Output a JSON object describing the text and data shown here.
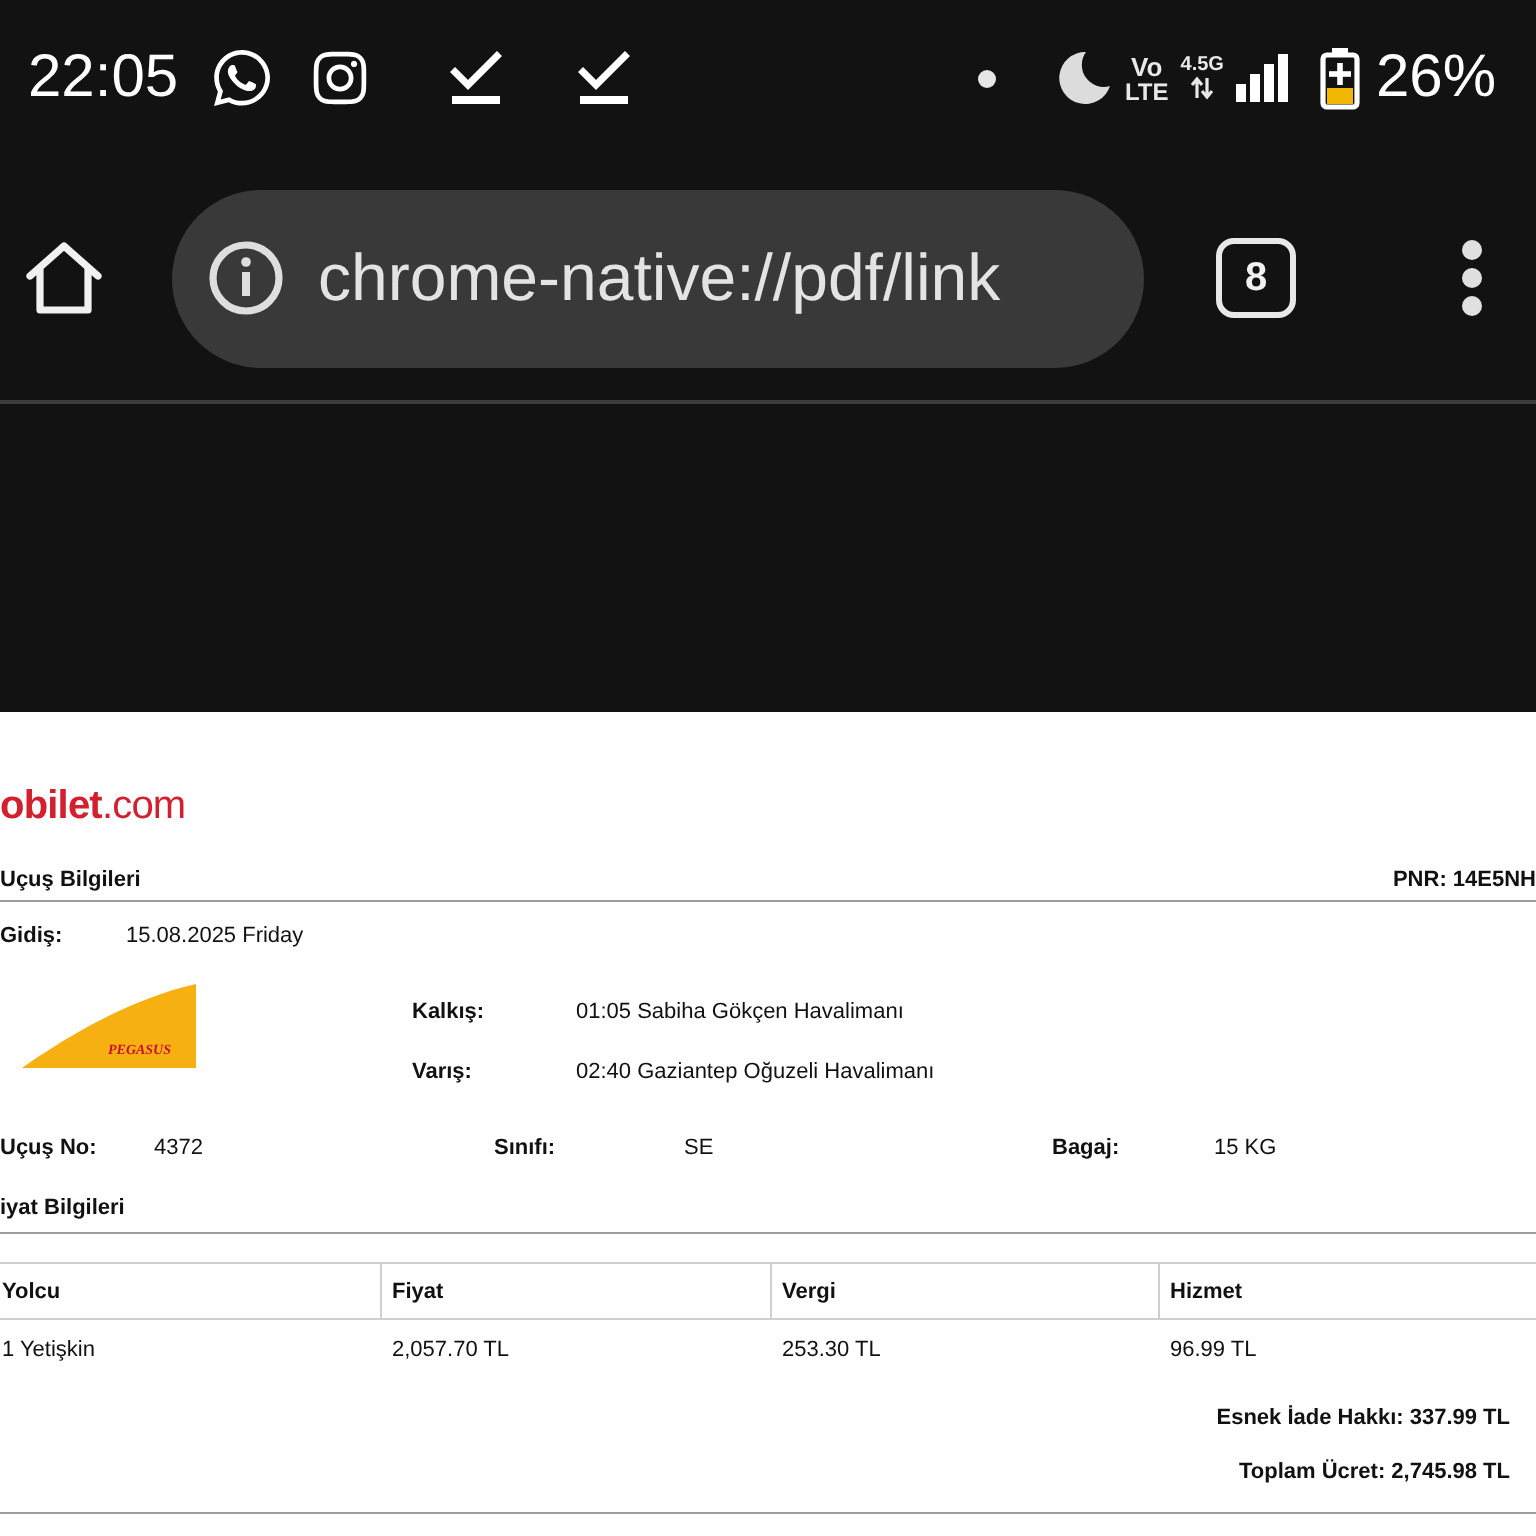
{
  "status_bar": {
    "time": "22:05",
    "network": {
      "volte_top": "Vo",
      "volte_bottom": "LTE",
      "generation": "4.5G"
    },
    "battery": "26%"
  },
  "browser": {
    "url": "chrome-native://pdf/link",
    "tab_count": "8"
  },
  "document": {
    "logo": "**obilet**.com",
    "flight_section": {
      "title": "Uçuş Bilgileri",
      "pnr": "PNR: 14E5NH"
    },
    "departure": {
      "label": "Gidiş:",
      "value": "15.08.2025 Friday"
    },
    "airline_logo": {
      "text": "PEGASUS"
    },
    "route": [
      {
        "label": "Kalkış:",
        "value": "01:05 Sabiha Gökçen Havalimanı"
      },
      {
        "label": "Varış:",
        "value": "02:40 Gaziantep Oğuzeli Havalimanı"
      }
    ],
    "details": [
      {
        "label": "Uçuş No:",
        "value": "4372"
      },
      {
        "label": "Sınıfı:",
        "value": "SE"
      },
      {
        "label": "Bagaj:",
        "value": "15 KG"
      }
    ],
    "price_section": {
      "title": "iyat Bilgileri"
    },
    "price_table": {
      "columns": [
        "Yolcu",
        "Fiyat",
        "Vergi",
        "Hizmet"
      ],
      "rows": [
        [
          "1 Yetişkin",
          "2,057.70 TL",
          "253.30 TL",
          "96.99 TL"
        ]
      ]
    },
    "totals": [
      "Esnek İade Hakkı: 337.99 TL",
      "Toplam Ücret: 2,745.98 TL"
    ]
  }
}
